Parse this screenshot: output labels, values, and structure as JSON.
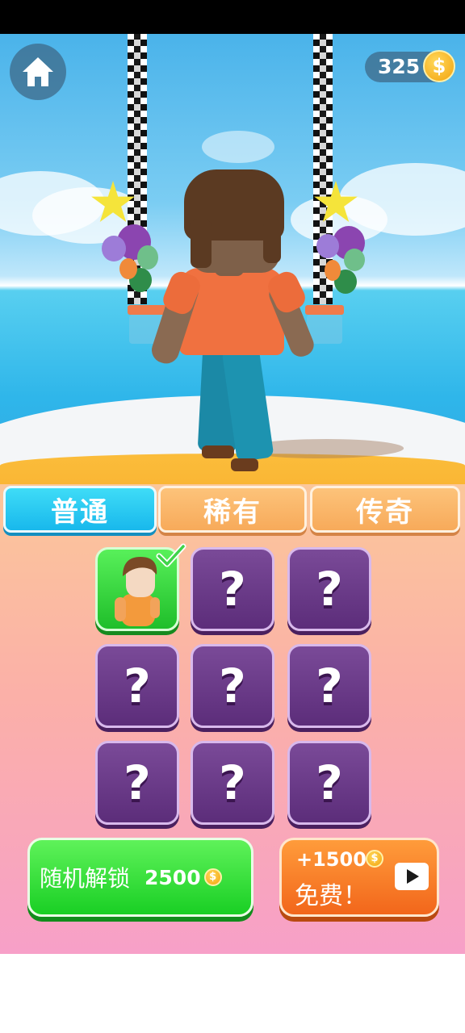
{
  "header": {
    "coins": "325",
    "coin_symbol": "$",
    "home_icon": "home-icon"
  },
  "tabs": [
    {
      "label": "普通",
      "active": true
    },
    {
      "label": "稀有",
      "active": false
    },
    {
      "label": "传奇",
      "active": false
    }
  ],
  "grid": {
    "question_mark": "?",
    "selected_index": 0,
    "slots": 9
  },
  "buttons": {
    "random_unlock_label": "随机解锁",
    "random_unlock_cost": "2500",
    "free_reward": "+1500",
    "free_label": "免费！",
    "coin_symbol": "$"
  },
  "colors": {
    "tab_active": "#18b8ec",
    "tab_inactive": "#f7aa5a",
    "slot_locked": "#5c2d7a",
    "slot_selected": "#1fbe2a",
    "random_button": "#19cf24",
    "free_button": "#f2661b"
  }
}
